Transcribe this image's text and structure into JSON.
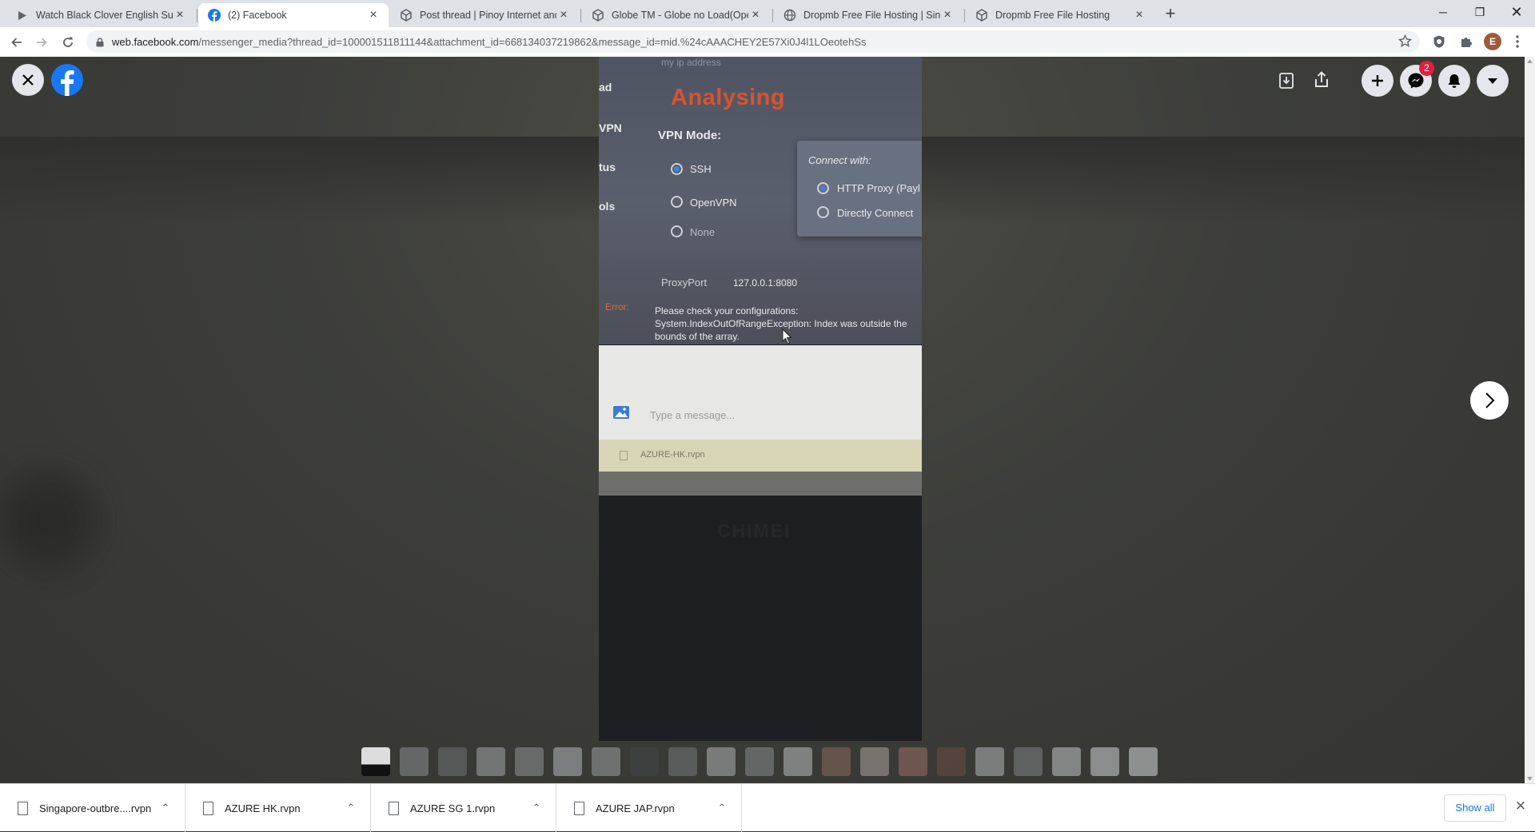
{
  "browser": {
    "tabs": [
      {
        "title": "Watch Black Clover English Subb",
        "icon": "play-icon"
      },
      {
        "title": "(2) Facebook",
        "icon": "facebook-icon"
      },
      {
        "title": "Post thread | Pinoy Internet and",
        "icon": "globe-cube-icon"
      },
      {
        "title": "Globe TM - Globe no Load(Oper",
        "icon": "globe-cube-icon"
      },
      {
        "title": "Dropmb Free File Hosting | Singa",
        "icon": "globe-icon"
      },
      {
        "title": "Dropmb Free File Hosting",
        "icon": "globe-cube-icon"
      }
    ],
    "url_host": "web.facebook.com",
    "url_path": "/messenger_media?thread_id=100001511811144&attachment_id=668134037219862&message_id=mid.%24cAAACHEY2E57Xi0J4l1LOeotehSs",
    "profile_initial": "E"
  },
  "viewer": {
    "messenger_badge": "2"
  },
  "photo": {
    "sidebar_labels": [
      "ad",
      "VPN",
      "tus",
      "ols"
    ],
    "top_faint": "my ip address",
    "heading": "Analysing",
    "vpn_mode_label": "VPN Mode:",
    "modes": [
      "SSH",
      "OpenVPN",
      "None"
    ],
    "connect_with_label": "Connect with:",
    "connect_options": [
      "HTTP Proxy (Payl",
      "Directly Connect"
    ],
    "proxyport_label": "ProxyPort",
    "proxyport_value": "127.0.0.1:8080",
    "error_label": "Error:",
    "error_text_1": "Please check your configurations:",
    "error_text_2": "System.IndexOutOfRangeException: Index was outside the",
    "error_text_3": "bounds of the array.",
    "message_placeholder": "Type a message...",
    "attached_file": "AZURE-HK.rvpn",
    "laptop_brand": "CHIMEI"
  },
  "downloads": {
    "items": [
      "Singapore-outbre....rvpn",
      "AZURE HK.rvpn",
      "AZURE SG 1.rvpn",
      "AZURE JAP.rvpn"
    ],
    "show_all": "Show all"
  },
  "colors": {
    "facebook_blue": "#1877f2",
    "badge_red": "#e41e3f",
    "chrome_tab_bg": "#dee1e6",
    "link_blue": "#1a73e8"
  }
}
